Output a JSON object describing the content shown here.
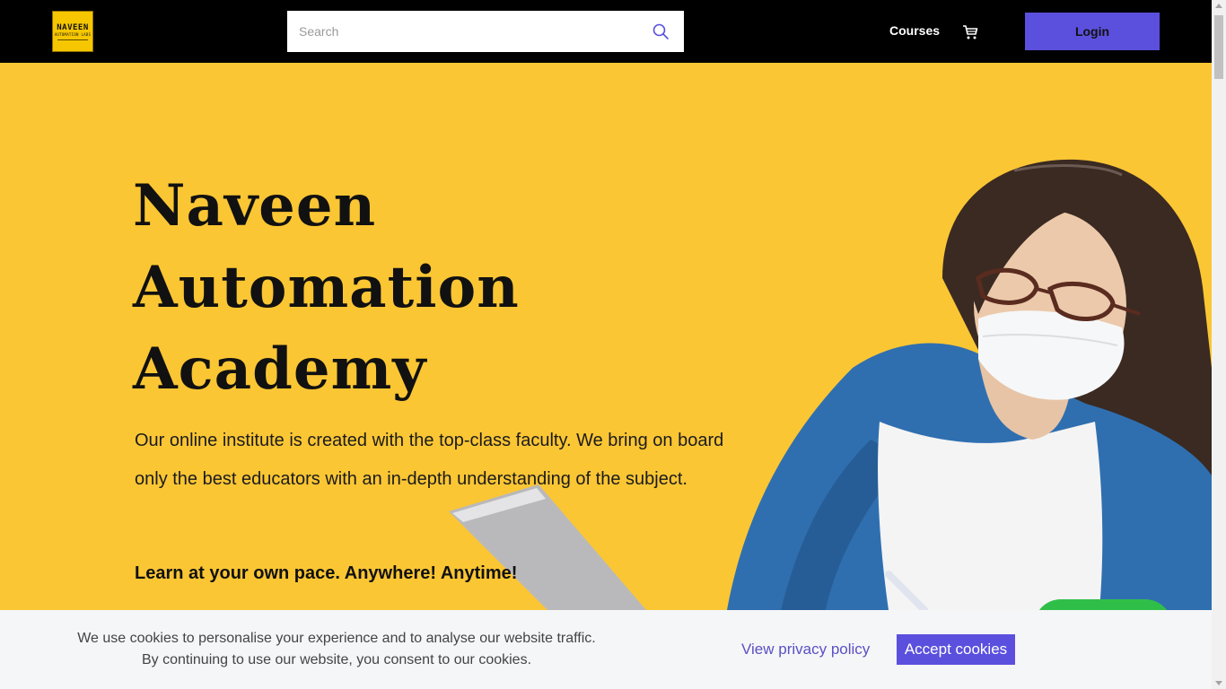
{
  "header": {
    "logo_line1": "NAVEEN",
    "logo_line2": "AUTOMATION LABS",
    "search_placeholder": "Search",
    "nav_courses": "Courses",
    "login_label": "Login"
  },
  "hero": {
    "title_lines": [
      "Naveen",
      "Automation",
      "Academy"
    ],
    "description": "Our online institute is created with the top-class faculty. We bring on board only the best educators with an in-depth understanding of the subject.",
    "tagline": "Learn at your own pace. Anywhere! Anytime!"
  },
  "cookie_banner": {
    "text": "We use cookies to personalise your experience and to analyse our website traffic. By continuing to use our website, you consent to our cookies.",
    "policy_link": "View privacy policy",
    "accept_label": "Accept cookies"
  },
  "colors": {
    "hero_bg": "#fbc634",
    "accent": "#5b50dd",
    "topbar": "#000000",
    "chat_widget": "#2fbf48"
  },
  "icons": {
    "search": "search-icon",
    "cart": "cart-icon"
  }
}
